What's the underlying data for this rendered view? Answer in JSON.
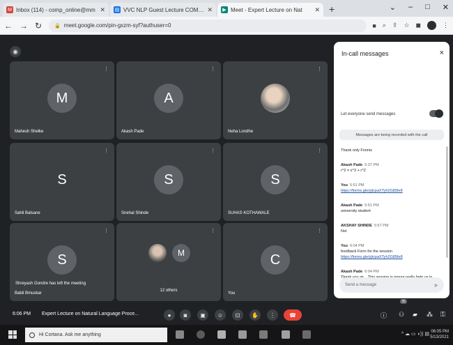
{
  "browser": {
    "tabs": [
      {
        "title": "Inbox (114) - comp_online@mm",
        "favicon": "gmail-icon",
        "active": false
      },
      {
        "title": "VVC NLP Guest Lecture COMP A",
        "favicon": "doc-icon",
        "active": false
      },
      {
        "title": "Meet - Expert Lecture on Nat",
        "favicon": "meet-icon",
        "active": true
      }
    ],
    "new_tab": "+",
    "url": "meet.google.com/pin-gxzm-syf?authuser=0"
  },
  "tiles": [
    {
      "initial": "M",
      "name": "Mahesh Shelke",
      "color": "#5f6368"
    },
    {
      "initial": "A",
      "name": "Akash Pade",
      "color": "#5f6368"
    },
    {
      "initial": "",
      "name": "Neha Londhe",
      "color": "#9aa0a6",
      "photo": true
    },
    {
      "initial": "S",
      "name": "Sahil Balsane",
      "color": "#3c4043"
    },
    {
      "initial": "S",
      "name": "Snehal Shinde",
      "color": "#5f6368"
    },
    {
      "initial": "S",
      "name": "SUHAS KOTHAWALE",
      "color": "#5f6368"
    },
    {
      "initial": "S",
      "name": "Babil Bmuskar",
      "color": "#5f6368",
      "left_msg": "Shreyash Gondre has left the meeting"
    },
    {
      "initial": "",
      "name": "",
      "color": "#3c4043",
      "others": "12 others",
      "mini_initial": "M"
    },
    {
      "initial": "C",
      "name": "You",
      "color": "#5f6368"
    }
  ],
  "chat": {
    "title": "In-call messages",
    "close": "×",
    "toggle_label": "Let everyone send messages",
    "recording_note": "Messages are being recorded with the call",
    "messages": [
      {
        "sender": "",
        "time": "",
        "text": "Thank only Fnnnis",
        "link": ""
      },
      {
        "sender": "Akash Pade",
        "time": "5:37 PM",
        "text": "r^2 = x^2 + r^2",
        "link": ""
      },
      {
        "sender": "You",
        "time": "5:51 PM",
        "text": "",
        "link": "https://forms.gle/yjtcpaXTyh2G85fe8"
      },
      {
        "sender": "Akash Pade",
        "time": "5:51 PM",
        "text": "university student",
        "link": ""
      },
      {
        "sender": "AKSHAY SHINDE",
        "time": "5:57 PM",
        "text": "Nst",
        "link": ""
      },
      {
        "sender": "You",
        "time": "6:04 PM",
        "text": "feedback Form for the session",
        "link": "https://forms.gle/yjtcpaXTyh2G85fe8"
      },
      {
        "sender": "Akash Pade",
        "time": "6:04 PM",
        "text": "Thank you sir... This session is gonna really help us in future",
        "link": ""
      }
    ],
    "send_placeholder": "Send a message"
  },
  "meetbar": {
    "time": "6:06 PM",
    "title": "Expert Lecture on Natural Language Proce...",
    "participant_badge": "35"
  },
  "taskbar": {
    "search_placeholder": "Hi Cortana. Ask me anything",
    "clock_time": "06:05 PM",
    "clock_date": "5/13/2021"
  }
}
